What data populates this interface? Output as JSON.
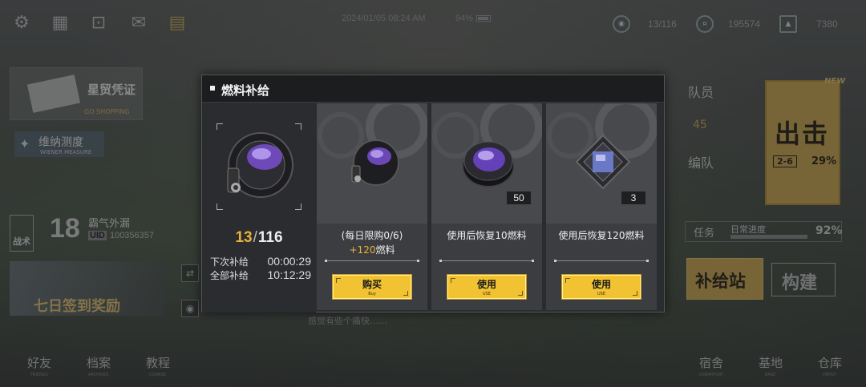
{
  "status": {
    "datetime": "2024/01/05 08:24 AM",
    "battery": "94%"
  },
  "resources": {
    "fuel": "13/116",
    "currency": "195574",
    "premium": "7380"
  },
  "topbar_icons": [
    "gear-icon",
    "calendar-icon",
    "notice-icon",
    "mail-icon",
    "radio-icon"
  ],
  "left": {
    "ticket_title": "星贸凭证",
    "ticket_sub": "GO SHOPPING",
    "wiener_title": "维纳测度",
    "wiener_sub": "WIENER MEASURE",
    "tactics_label": "战术",
    "level": "18",
    "player_name": "霸气外漏",
    "uid_label": "UID",
    "uid": "100356357",
    "banner_text": "七日签到奖励"
  },
  "right": {
    "team_label": "队员",
    "team_count": "45",
    "formation_label": "编队",
    "sortie_label": "出击",
    "new_tag": "NEW",
    "stage": "2-6",
    "sortie_pct": "29%",
    "task_label": "任务",
    "daily_label": "日常进度",
    "daily_pct": "92%",
    "supply_label": "补给站",
    "build_label": "构建"
  },
  "bottom_nav": [
    {
      "label": "好友",
      "sub": "FRIENDS"
    },
    {
      "label": "档案",
      "sub": "ARCHIVES"
    },
    {
      "label": "教程",
      "sub": "COURSE"
    },
    {
      "label": "宿舍",
      "sub": "DORMITORY"
    },
    {
      "label": "基地",
      "sub": "BASE"
    },
    {
      "label": "仓库",
      "sub": "DEPOT"
    }
  ],
  "chat_line": "感觉有些个痛快……",
  "modal": {
    "title": "燃料补给",
    "current": "13",
    "max": "116",
    "next_label": "下次补给",
    "next_time": "00:00:29",
    "all_label": "全部补给",
    "all_time": "10:12:29",
    "cards": [
      {
        "desc": "(每日限购0/6)",
        "desc2": "+120",
        "desc2_suffix": "燃料",
        "qty": "",
        "btn": "购买",
        "btn_sub": "Buy"
      },
      {
        "desc": "使用后恢复10燃料",
        "desc2": "",
        "desc2_suffix": "",
        "qty": "50",
        "btn": "使用",
        "btn_sub": "USE"
      },
      {
        "desc": "使用后恢复120燃料",
        "desc2": "",
        "desc2_suffix": "",
        "qty": "3",
        "btn": "使用",
        "btn_sub": "USE"
      }
    ]
  },
  "colors": {
    "accent_gold": "#e9b23b",
    "button_yellow": "#f1c232",
    "modal_bg": "#2a2c2f"
  }
}
